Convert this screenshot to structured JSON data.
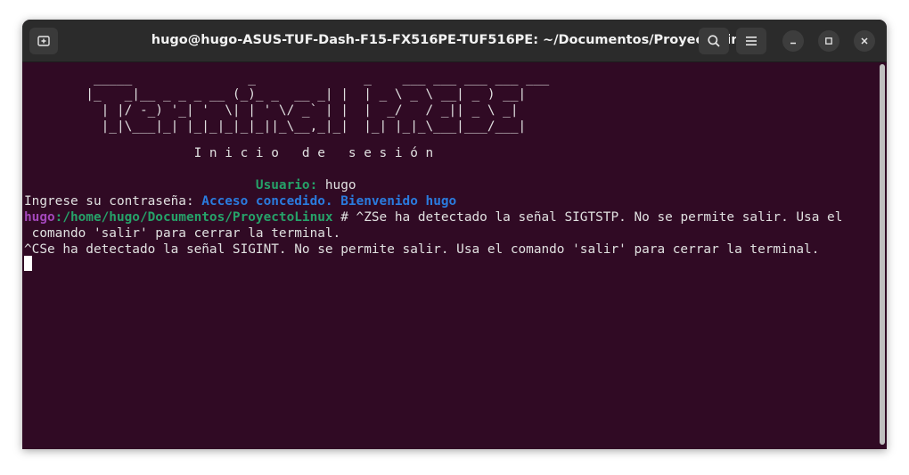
{
  "window": {
    "title": "hugo@hugo-ASUS-TUF-Dash-F15-FX516PE-TUF516PE: ~/Documentos/ProyectoLinux"
  },
  "icons": {
    "new_tab": "new-tab-icon",
    "search": "search-icon",
    "menu": "hamburger-menu-icon",
    "minimize": "minimize-icon",
    "maximize": "maximize-icon",
    "close": "close-icon"
  },
  "colors": {
    "terminal_bg": "#300a24",
    "green": "#26a269",
    "blue": "#2a7bde",
    "purple": "#a347ba"
  },
  "terminal": {
    "banner": [
      "         _____               _              _    ___ ___ ___ ___ ___",
      "        |_   _|__ _ _ _ __ (_)_ _  __ _| |  | _ \\ _ \\ __| _ ) __|",
      "          | |/ -_) '_| '  \\| | ' \\/ _` | |  |  _/   / _|| _ \\ _|",
      "          |_|\\___|_| |_|_|_|_|_||_\\__,_|_|  |_| |_|_\\___|___/___|"
    ],
    "heading": "                      I n i c i o   d e   s e s i ó n",
    "usuario_label": "                              Usuario:",
    "usuario_value": " hugo",
    "password_prompt": "Ingrese su contraseña: ",
    "access_msg": "Acceso concedido.",
    "welcome_msg": " Bienvenido hugo",
    "prompt_user": "hugo",
    "prompt_path": ":/home/hugo/Documentos/ProyectoLinux",
    "prompt_rest": " # ^ZSe ha detectado la señal SIGTSTP. No se permite salir. Usa el",
    "wrap_line": " comando 'salir' para cerrar la terminal.",
    "sigint_line": "^CSe ha detectado la señal SIGINT. No se permite salir. Usa el comando 'salir' para cerrar la terminal."
  }
}
